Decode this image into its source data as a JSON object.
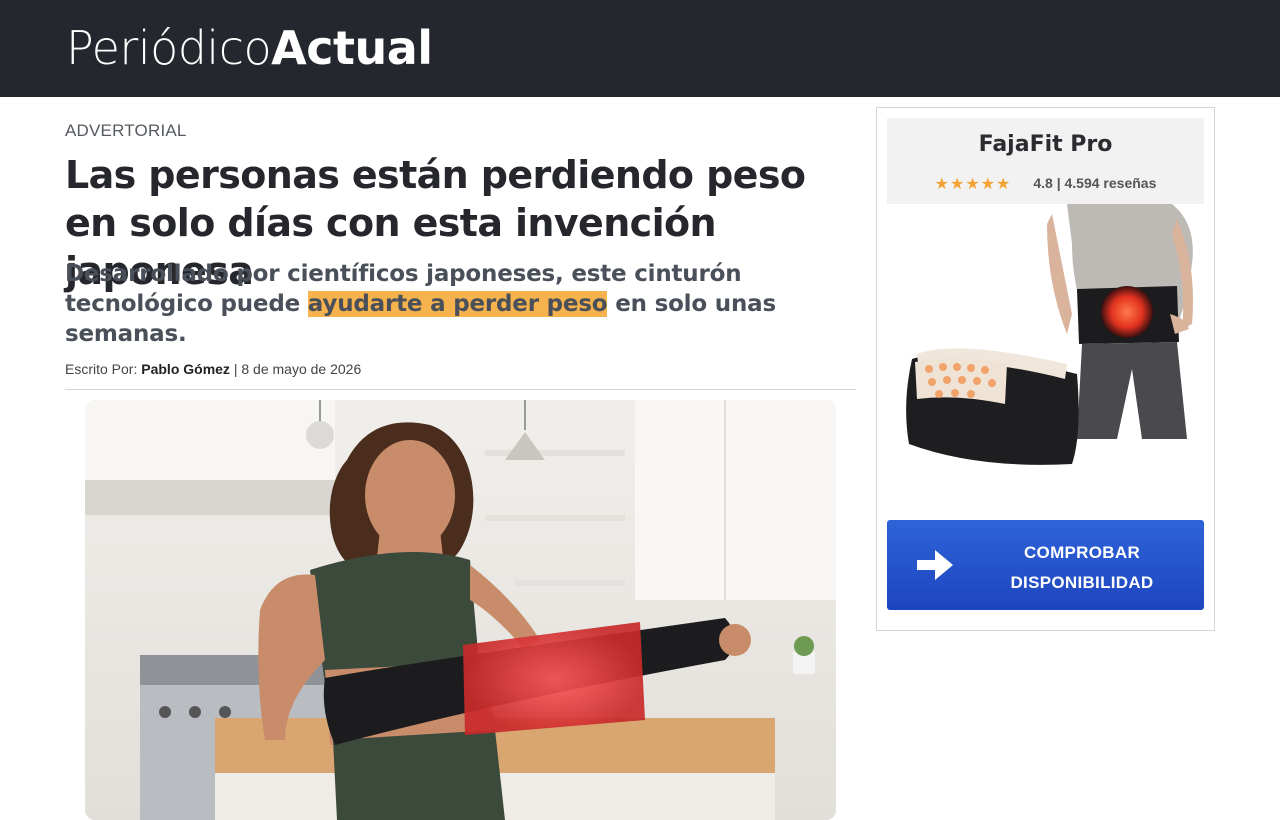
{
  "header": {
    "logo_light": "Periódico",
    "logo_bold": "Actual"
  },
  "article": {
    "kicker": "ADVERTORIAL",
    "headline": "Las personas están perdiendo peso en solo días con esta invención japonesa",
    "subhead_before": "Desarrollado por científicos japoneses, este cinturón tecnológico puede ",
    "subhead_highlight": "ayudarte a perder peso",
    "subhead_after": " en solo unas semanas.",
    "byline_prefix": "Escrito Por: ",
    "author": "Pablo Gómez",
    "separator": " | ",
    "date": "8 de mayo de 2026",
    "highlight_color": "#f6b24c"
  },
  "sidebar": {
    "product_name": "FajaFit Pro",
    "stars": "★★★★★",
    "rating_value": 4.5,
    "rating_text": "4.8 | 4.594 reseñas",
    "cta_line1": "COMPROBAR",
    "cta_line2": "DISPONIBILIDAD",
    "cta_color": "#2a58d2"
  },
  "icons": {
    "cta": "arrow-right-icon",
    "rating": "star-icon"
  }
}
